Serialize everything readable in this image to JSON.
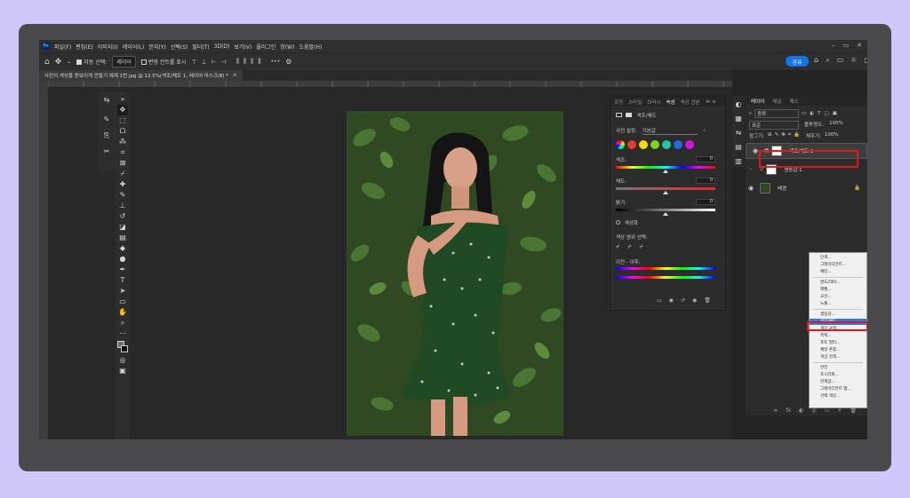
{
  "menubar": {
    "logo": "Ps",
    "items": [
      "파일(F)",
      "편집(E)",
      "이미지(I)",
      "레이어(L)",
      "문자(Y)",
      "선택(S)",
      "필터(T)",
      "3D(D)",
      "보기(V)",
      "플러그인",
      "창(W)",
      "도움말(H)"
    ],
    "controls": [
      "–",
      "▭",
      "✕"
    ]
  },
  "options": {
    "auto_select_label": "자동 선택:",
    "auto_select_value": "레이어",
    "transform_label": "변형 컨트롤 표시",
    "more": "•••",
    "share_label": "공유"
  },
  "document_tab": {
    "title": "사진의 색상을 돋보이게 만들기 예제 1번.jpg @ 12.5%(색조/채도 1, 레이어 마스크/8) *",
    "close": "×"
  },
  "properties_panel": {
    "tabs": [
      "조정",
      "스타일",
      "브러시",
      "속성",
      "색상 견본"
    ],
    "active_tab": "속성",
    "header": "색조/채도",
    "preset_label": "사전 설정:",
    "preset_value": "기본값",
    "hue_label": "색조:",
    "hue_value": "0",
    "saturation_label": "채도:",
    "saturation_value": "0",
    "lightness_label": "밝기:",
    "lightness_value": "0",
    "colorize_label": "색상화",
    "range_label": "색상 범위 선택:",
    "preview_label": "이전 - 이후:",
    "swatch_colors": [
      "#e53935",
      "#f5d800",
      "#7ed321",
      "#21c7a8",
      "#1e6be0",
      "#d316d9"
    ]
  },
  "layers_panel": {
    "tabs": [
      "레이어",
      "채널",
      "패스"
    ],
    "active_tab": "레이어",
    "filter_label": "종류",
    "blend_mode": "표준",
    "opacity_label": "불투명도:",
    "opacity_value": "100%",
    "lock_label": "잠그기:",
    "fill_label": "채우기:",
    "fill_value": "100%",
    "layers": [
      {
        "name": "색조/채도 1",
        "selected": true
      },
      {
        "name": "생동감 1",
        "selected": false
      },
      {
        "name": "배경",
        "selected": false
      }
    ],
    "bottom_icons": [
      "∞",
      "fx",
      "◐",
      "◎",
      "▭",
      "+",
      "🗑"
    ]
  },
  "context_menu": {
    "items": [
      "단색...",
      "그레이디언트...",
      "패턴...",
      "명도/대비...",
      "레벨...",
      "곡선...",
      "노출...",
      "생동감...",
      "색조/채도...",
      "색상 균형...",
      "흑백...",
      "포토 필터...",
      "채널 혼합...",
      "색상 검색...",
      "반전",
      "포스터화...",
      "한계값...",
      "그레이디언트 맵...",
      "선택 색상..."
    ],
    "highlighted": "색조/채도..."
  }
}
